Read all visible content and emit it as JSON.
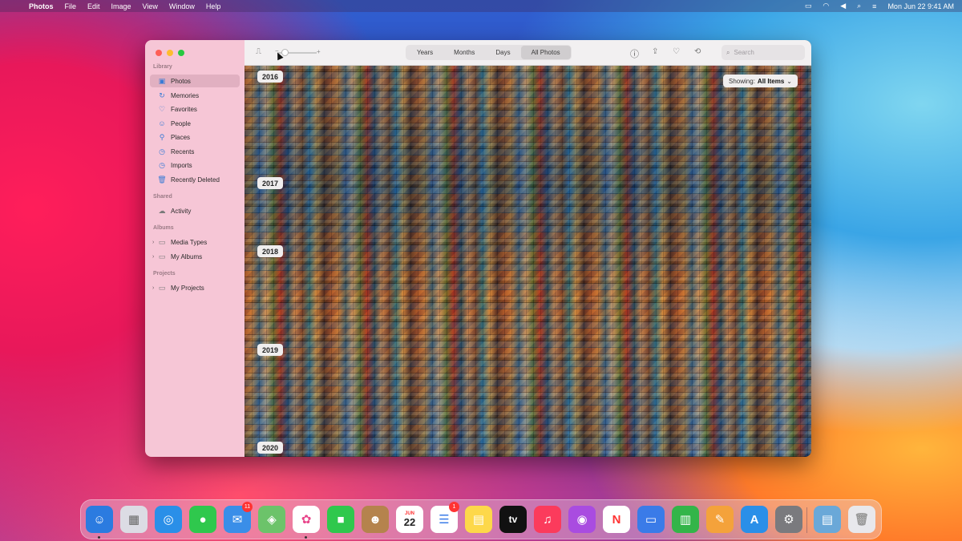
{
  "menubar": {
    "app_name": "Photos",
    "menus": [
      "File",
      "Edit",
      "Image",
      "View",
      "Window",
      "Help"
    ],
    "datetime": "Mon Jun 22  9:41 AM"
  },
  "sidebar": {
    "sections": {
      "library": "Library",
      "shared": "Shared",
      "albums": "Albums",
      "projects": "Projects"
    },
    "library_items": [
      {
        "label": "Photos",
        "icon": "photos-icon"
      },
      {
        "label": "Memories",
        "icon": "memories-icon"
      },
      {
        "label": "Favorites",
        "icon": "heart-icon"
      },
      {
        "label": "People",
        "icon": "person-icon"
      },
      {
        "label": "Places",
        "icon": "pin-icon"
      },
      {
        "label": "Recents",
        "icon": "clock-icon"
      },
      {
        "label": "Imports",
        "icon": "clock-icon"
      },
      {
        "label": "Recently Deleted",
        "icon": "trash-icon"
      }
    ],
    "shared_items": [
      {
        "label": "Activity",
        "icon": "cloud-icon"
      }
    ],
    "album_items": [
      {
        "label": "Media Types",
        "icon": "folder-icon"
      },
      {
        "label": "My Albums",
        "icon": "folder-icon"
      }
    ],
    "project_items": [
      {
        "label": "My Projects",
        "icon": "folder-icon"
      }
    ]
  },
  "toolbar": {
    "zoom_minus": "−",
    "zoom_plus": "+",
    "tabs": [
      "Years",
      "Months",
      "Days",
      "All Photos"
    ],
    "active_tab": "All Photos",
    "search_placeholder": "Search"
  },
  "content": {
    "showing_label": "Showing:",
    "showing_value": "All Items",
    "years": [
      "2016",
      "2017",
      "2018",
      "2019",
      "2020"
    ]
  },
  "dock": {
    "apps": [
      {
        "name": "finder-icon",
        "color": "#2b7be0"
      },
      {
        "name": "launchpad-icon",
        "color": "#dcdce4"
      },
      {
        "name": "safari-icon",
        "color": "#2a8fe8"
      },
      {
        "name": "messages-icon",
        "color": "#2fc84d"
      },
      {
        "name": "mail-icon",
        "color": "#3a8ee8",
        "badge": "11"
      },
      {
        "name": "maps-icon",
        "color": "#6cc36a"
      },
      {
        "name": "photos-icon",
        "color": "#ffffff"
      },
      {
        "name": "facetime-icon",
        "color": "#2fc84d"
      },
      {
        "name": "contacts-icon",
        "color": "#b5834d"
      },
      {
        "name": "calendar-icon",
        "color": "#ffffff",
        "month": "JUN",
        "day": "22"
      },
      {
        "name": "reminders-icon",
        "color": "#ffffff",
        "badge": "1"
      },
      {
        "name": "notes-icon",
        "color": "#fdd84a"
      },
      {
        "name": "tv-icon",
        "color": "#111111",
        "text": "tv"
      },
      {
        "name": "music-icon",
        "color": "#fb3b5c"
      },
      {
        "name": "podcasts-icon",
        "color": "#a94ce0"
      },
      {
        "name": "news-icon",
        "color": "#ffffff"
      },
      {
        "name": "keynote-icon",
        "color": "#3a7be8"
      },
      {
        "name": "numbers-icon",
        "color": "#33b549"
      },
      {
        "name": "pages-icon",
        "color": "#f4a23b"
      },
      {
        "name": "appstore-icon",
        "color": "#2a8fe8"
      },
      {
        "name": "system-preferences-icon",
        "color": "#7a7a7e"
      },
      {
        "name": "downloads-folder-icon",
        "color": "#6aa8d8"
      },
      {
        "name": "trash-icon",
        "color": "#e8e8ec"
      }
    ]
  }
}
